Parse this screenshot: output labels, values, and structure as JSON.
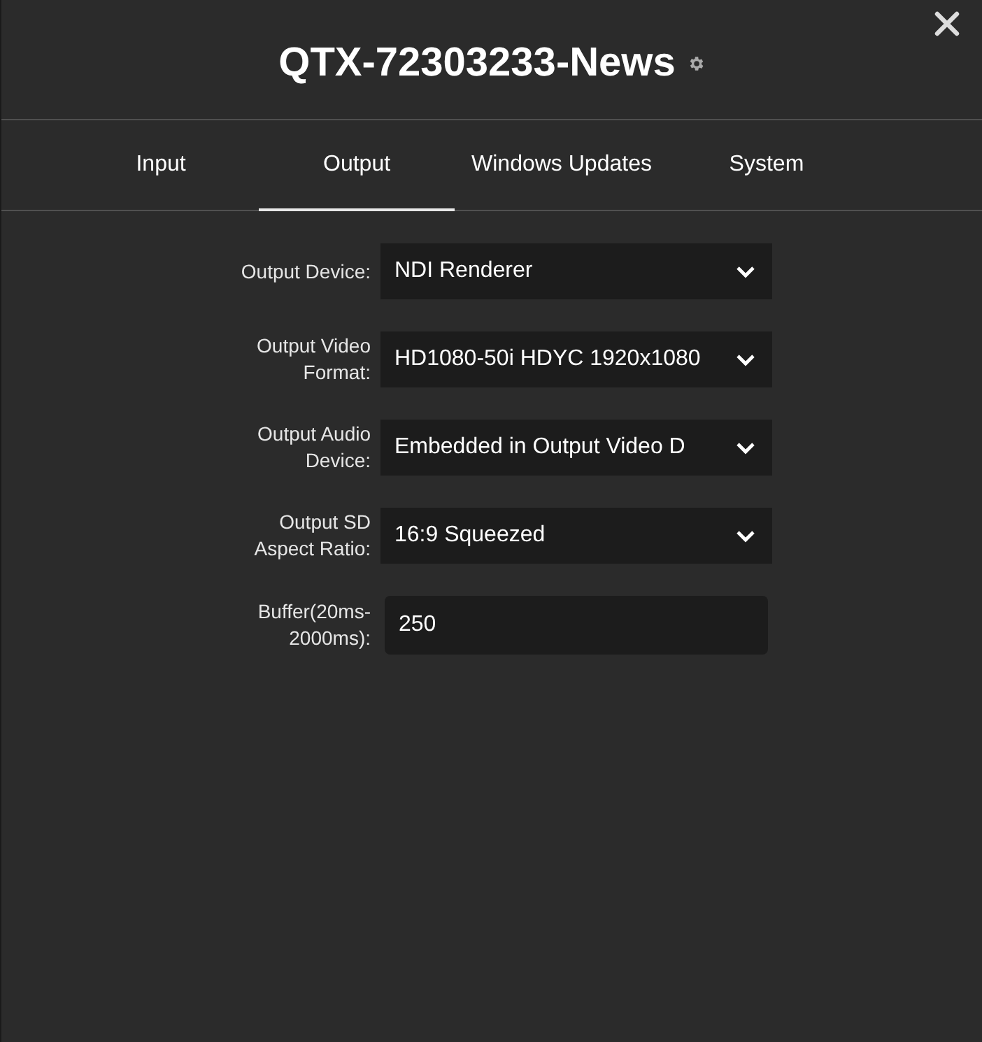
{
  "window": {
    "title": "QTX-72303233-News"
  },
  "tabs": [
    {
      "label": "Input",
      "selected": false
    },
    {
      "label": "Output",
      "selected": true
    },
    {
      "label": "Windows Updates",
      "selected": false
    },
    {
      "label": "System",
      "selected": false
    }
  ],
  "fields": [
    {
      "kind": "select",
      "label": "Output Device:",
      "value": "NDI Renderer"
    },
    {
      "kind": "select",
      "label": "Output Video Format:",
      "value": "HD1080-50i HDYC 1920x1080"
    },
    {
      "kind": "select",
      "label": "Output Audio Device:",
      "value": "Embedded in Output Video D"
    },
    {
      "kind": "select",
      "label": "Output SD Aspect Ratio:",
      "value": "16:9 Squeezed"
    },
    {
      "kind": "input",
      "label": "Buffer(20ms-2000ms):",
      "value": "250"
    }
  ]
}
